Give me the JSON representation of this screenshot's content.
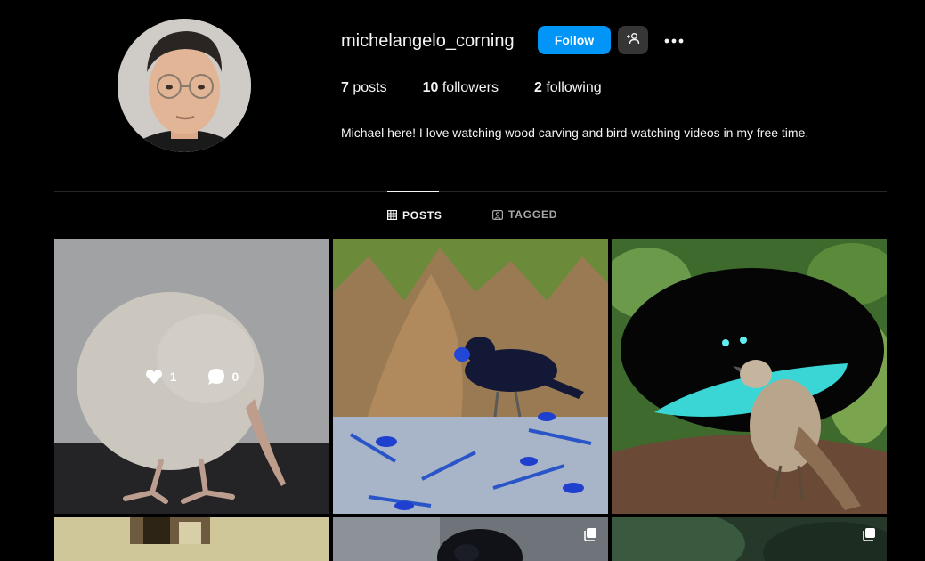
{
  "profile": {
    "username": "michelangelo_corning",
    "follow_label": "Follow",
    "posts_count": "7",
    "posts_label": "posts",
    "followers_count": "10",
    "followers_label": "followers",
    "following_count": "2",
    "following_label": "following",
    "bio": "Michael here! I love watching wood carving and bird-watching videos in my free time."
  },
  "tabs": [
    {
      "label": "POSTS",
      "icon": "grid-icon",
      "active": true
    },
    {
      "label": "TAGGED",
      "icon": "tagged-icon",
      "active": false
    }
  ],
  "posts": [
    {
      "subject": "kiwi-bird",
      "likes": "1",
      "comments": "0",
      "hovered": true
    },
    {
      "subject": "bowerbird",
      "multi": false
    },
    {
      "subject": "bird-of-paradise",
      "multi": false
    },
    {
      "subject": "partial-building",
      "multi": false
    },
    {
      "subject": "partial-bird",
      "multi": true
    },
    {
      "subject": "partial-forest",
      "multi": true
    }
  ],
  "colors": {
    "accent": "#0095f6",
    "background": "#000000",
    "secondary_button": "#363636"
  }
}
